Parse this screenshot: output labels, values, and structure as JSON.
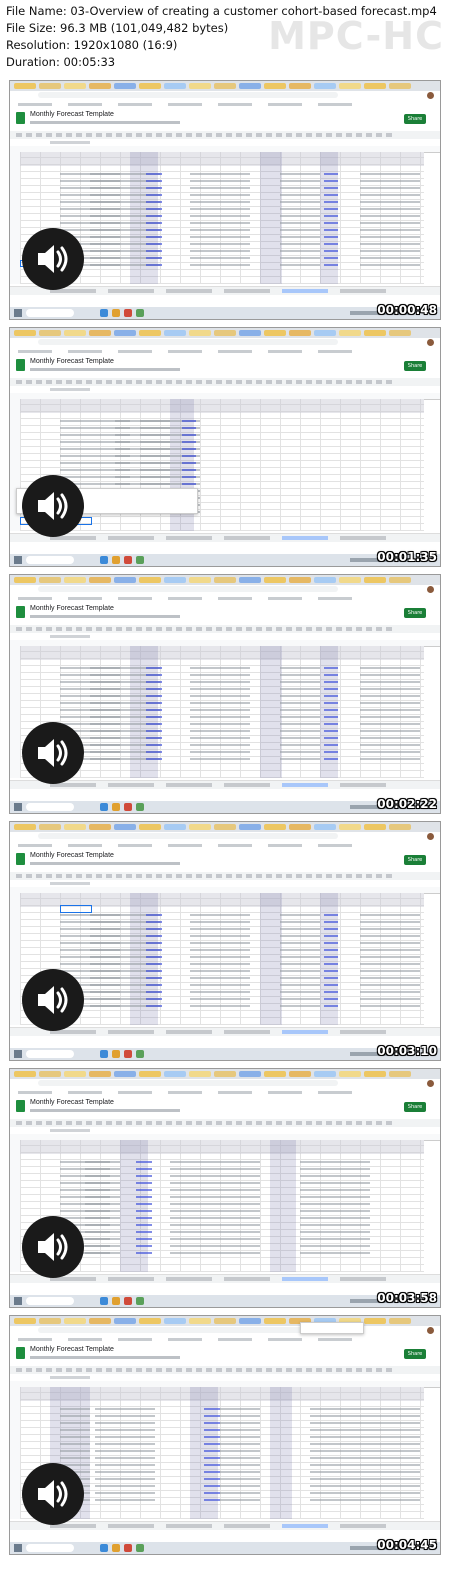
{
  "header": {
    "file_name": "File Name: 03-Overview of creating a customer cohort-based forecast.mp4",
    "file_size": "File Size: 96.3 MB (101,049,482 bytes)",
    "resolution": "Resolution: 1920x1080 (16:9)",
    "duration": "Duration: 00:05:33",
    "brand": "MPC-HC"
  },
  "app": {
    "doc_title": "Monthly Forecast Template",
    "share_label": "Share"
  },
  "thumbnails": [
    {
      "timestamp": "00:00:48"
    },
    {
      "timestamp": "00:01:35"
    },
    {
      "timestamp": "00:02:22"
    },
    {
      "timestamp": "00:03:10"
    },
    {
      "timestamp": "00:03:58"
    },
    {
      "timestamp": "00:04:45"
    }
  ],
  "icons": {
    "speaker": "speaker-volume-icon",
    "sheets_logo": "sheets-logo-icon",
    "windows": "windows-start-icon"
  },
  "colors": {
    "share_button": "#1a7f37",
    "highlight_blue": "#3d4fd9",
    "shaded_column": "#a7a7c8",
    "selection": "#1a73e8"
  }
}
